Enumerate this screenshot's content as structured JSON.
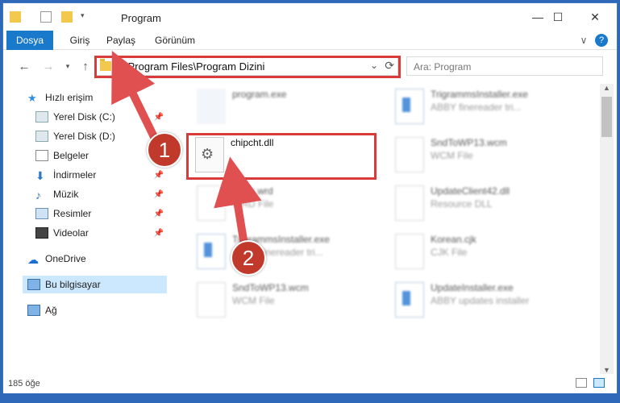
{
  "window": {
    "title": "Program"
  },
  "titlebar": {
    "minimize": "—",
    "maximize": "☐",
    "close": "✕"
  },
  "ribbon": {
    "tabs": [
      "Dosya",
      "Giriş",
      "Paylaş",
      "Görünüm"
    ],
    "expand": "∨",
    "help": "?"
  },
  "address": {
    "path": "C:\\Program Files\\Program Dizini",
    "search_placeholder": "Ara: Program"
  },
  "sidebar": {
    "items": [
      {
        "label": "Hızlı erişim"
      },
      {
        "label": "Yerel Disk (C:)"
      },
      {
        "label": "Yerel Disk (D:)"
      },
      {
        "label": "Belgeler"
      },
      {
        "label": "İndirmeler"
      },
      {
        "label": "Müzik"
      },
      {
        "label": "Resimler"
      },
      {
        "label": "Videolar"
      },
      {
        "label": "OneDrive"
      },
      {
        "label": "Bu bilgisayar"
      },
      {
        "label": "Ağ"
      }
    ]
  },
  "files": [
    {
      "name": "program.exe",
      "sub": ""
    },
    {
      "name": "TrigrammsInstaller.exe",
      "sub": "ABBY finereader tri..."
    },
    {
      "name": "chipcht.dll",
      "sub": ""
    },
    {
      "name": "SndToWP13.wcm",
      "sub": "WCM File"
    },
    {
      "name": "basic.wrd",
      "sub": "WRD File"
    },
    {
      "name": "UpdateClient42.dll",
      "sub": "Resource DLL"
    },
    {
      "name": "TrigrammsInstaller.exe",
      "sub": "ABBY finereader tri..."
    },
    {
      "name": "Korean.cjk",
      "sub": "CJK File"
    },
    {
      "name": "SndToWP13.wcm",
      "sub": "WCM File"
    },
    {
      "name": "UpdateInstaller.exe",
      "sub": "ABBY updates installer"
    }
  ],
  "status": {
    "count": "185 öğe"
  },
  "annotations": {
    "step1": "1",
    "step2": "2"
  },
  "colors": {
    "accent": "#1979ca",
    "highlight": "#d93a3a",
    "badge": "#c0392b",
    "selection": "#cce8ff"
  }
}
